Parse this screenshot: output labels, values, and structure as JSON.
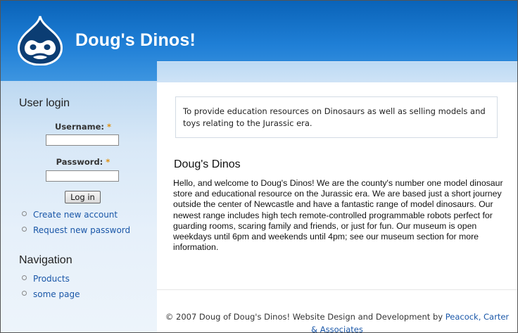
{
  "header": {
    "site_name": "Doug's Dinos!"
  },
  "sidebar": {
    "login_title": "User login",
    "username_label": "Username:",
    "password_label": "Password:",
    "required_mark": "*",
    "login_button": "Log in",
    "links": [
      "Create new account",
      "Request new password"
    ],
    "nav_title": "Navigation",
    "nav_items": [
      "Products",
      "some page"
    ]
  },
  "main": {
    "mission": "To provide education resources on Dinosaurs as well as selling models and toys relating to the Jurassic era.",
    "node_title": "Doug's Dinos",
    "node_body": "Hello, and welcome to Doug's Dinos! We are the county's number one model dinosaur store and educational resource on the Jurassic era. We are based just a short journey outside the center of Newcastle and have a fantastic range of model dinosaurs. Our newest range includes high tech remote-controlled programmable robots perfect for guarding rooms, scaring family and friends, or just for fun. Our museum is open weekdays until 6pm and weekends until 4pm; see our museum section for more information."
  },
  "footer": {
    "text": "© 2007 Doug of Doug's Dinos! Website Design and Development by",
    "link": "Peacock, Carter & Associates"
  },
  "colors": {
    "header_blue": "#1f7fd6",
    "link_blue": "#1a57a8",
    "required_orange": "#e09010"
  }
}
